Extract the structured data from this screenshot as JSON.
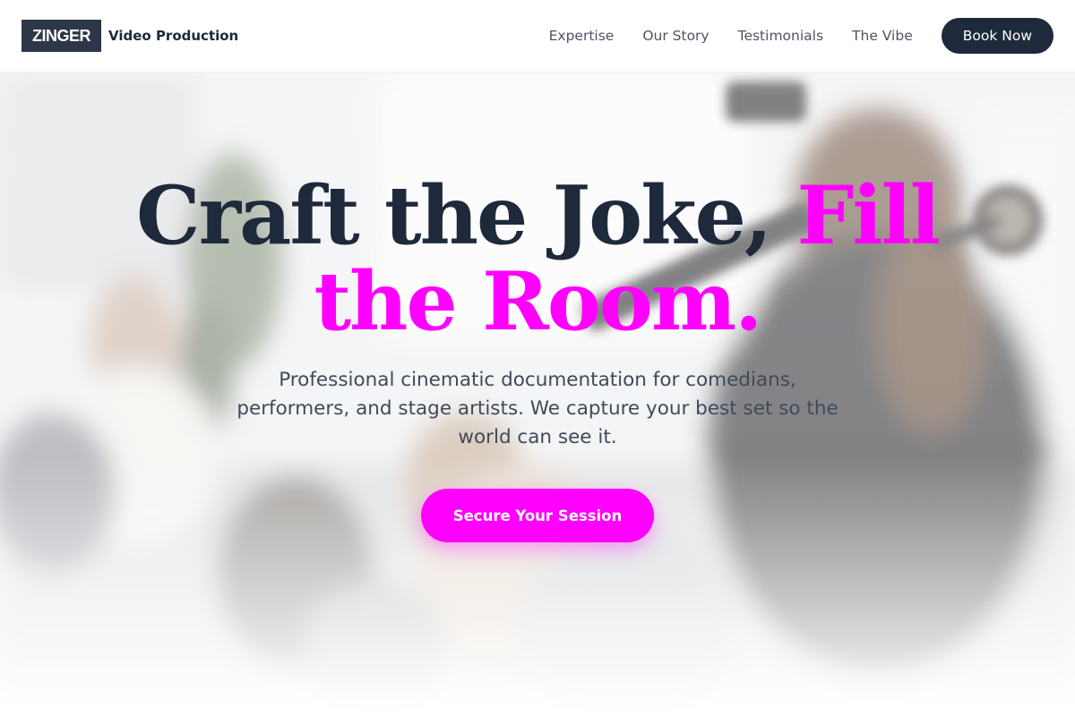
{
  "header": {
    "logo": "ZINGER",
    "brand_label": "Video Production",
    "nav": [
      "Expertise",
      "Our Story",
      "Testimonials",
      "The Vibe"
    ],
    "book_label": "Book Now"
  },
  "hero": {
    "headline_dark": "Craft the Joke,",
    "headline_accent": "Fill the Room.",
    "subtext": "Professional cinematic documentation for comedians, performers, and stage artists. We capture your best set so the world can see it.",
    "cta_label": "Secure Your Session",
    "background_image": "camera-operator-filming-audience"
  },
  "colors": {
    "accent": "#ff00ff",
    "dark": "#1e293b",
    "logo_bg": "#2d3748"
  }
}
